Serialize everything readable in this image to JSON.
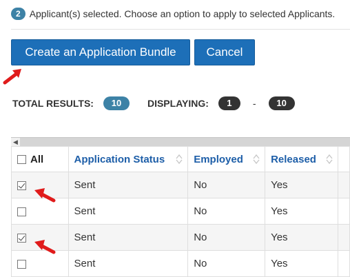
{
  "banner": {
    "selected_count": "2",
    "text": "Applicant(s) selected. Choose an option to apply to selected Applicants."
  },
  "buttons": {
    "bundle": "Create an Application Bundle",
    "cancel": "Cancel"
  },
  "results": {
    "total_label": "TOTAL RESULTS:",
    "total_value": "10",
    "displaying_label": "DISPLAYING:",
    "range_start": "1",
    "range_sep": "-",
    "range_end": "10"
  },
  "table": {
    "headers": {
      "all": "All",
      "status": "Application Status",
      "employed": "Employed",
      "released": "Released"
    },
    "rows": [
      {
        "checked": true,
        "status": "Sent",
        "employed": "No",
        "released": "Yes"
      },
      {
        "checked": false,
        "status": "Sent",
        "employed": "No",
        "released": "Yes"
      },
      {
        "checked": true,
        "status": "Sent",
        "employed": "No",
        "released": "Yes"
      },
      {
        "checked": false,
        "status": "Sent",
        "employed": "No",
        "released": "Yes"
      }
    ]
  },
  "colors": {
    "primary_button": "#1d6fb8",
    "badge_blue": "#3d82a6",
    "badge_dark": "#333333",
    "header_text": "#1d5ea8",
    "annotation_arrow": "#e01b1b"
  },
  "icons": {
    "sort": "sort-icon",
    "arrow": "red-arrow-annotation",
    "scroll_left": "chevron-left-icon"
  }
}
